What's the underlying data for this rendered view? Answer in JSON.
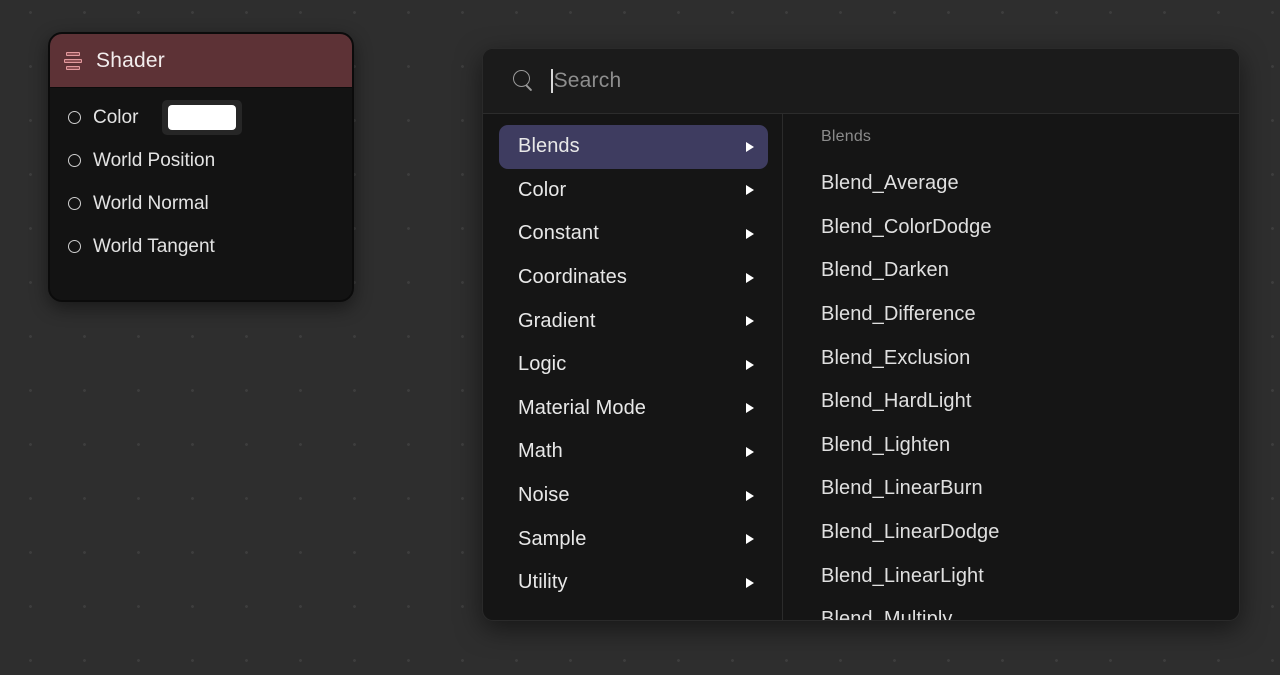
{
  "node": {
    "title": "Shader",
    "icon": "layers-stack-icon",
    "header_color": "#5d3236",
    "rows": [
      {
        "label": "Color",
        "port": "input-port-icon",
        "swatch": "#ffffff"
      },
      {
        "label": "World Position",
        "port": "input-port-icon"
      },
      {
        "label": "World Normal",
        "port": "input-port-icon"
      },
      {
        "label": "World Tangent",
        "port": "input-port-icon"
      }
    ]
  },
  "popup": {
    "search": {
      "icon": "search-icon",
      "placeholder": "Search",
      "value": ""
    },
    "categories": [
      {
        "label": "Blends",
        "selected": true
      },
      {
        "label": "Color",
        "selected": false
      },
      {
        "label": "Constant",
        "selected": false
      },
      {
        "label": "Coordinates",
        "selected": false
      },
      {
        "label": "Gradient",
        "selected": false
      },
      {
        "label": "Logic",
        "selected": false
      },
      {
        "label": "Material Mode",
        "selected": false
      },
      {
        "label": "Math",
        "selected": false
      },
      {
        "label": "Noise",
        "selected": false
      },
      {
        "label": "Sample",
        "selected": false
      },
      {
        "label": "Utility",
        "selected": false
      }
    ],
    "items": {
      "group_title": "Blends",
      "entries": [
        "Blend_Average",
        "Blend_ColorDodge",
        "Blend_Darken",
        "Blend_Difference",
        "Blend_Exclusion",
        "Blend_HardLight",
        "Blend_Lighten",
        "Blend_LinearBurn",
        "Blend_LinearDodge",
        "Blend_LinearLight",
        "Blend_Multiply"
      ]
    },
    "highlight_color": "#3e3c60"
  },
  "canvas": {
    "background_color": "#2e2e2e",
    "dot_color": "#3d3d3d"
  }
}
